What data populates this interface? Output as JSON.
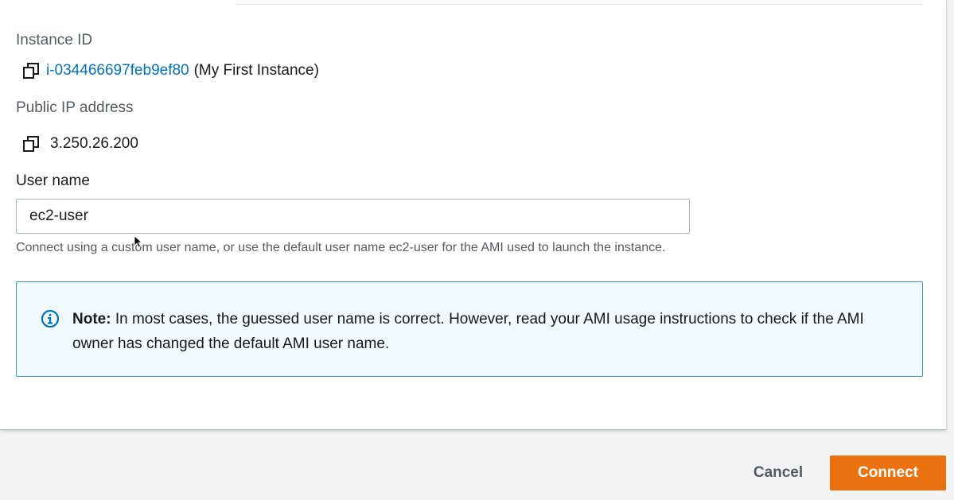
{
  "fields": {
    "instance_id": {
      "label": "Instance ID",
      "value": "i-034466697feb9ef80",
      "suffix": "(My First Instance)"
    },
    "public_ip": {
      "label": "Public IP address",
      "value": "3.250.26.200"
    },
    "user_name": {
      "label": "User name",
      "value": "ec2-user",
      "hint": "Connect using a custom user name, or use the default user name ec2-user for the AMI used to launch the instance."
    }
  },
  "note": {
    "title": "Note:",
    "text": "In most cases, the guessed user name is correct. However, read your AMI usage instructions to check if the AMI owner has changed the default AMI user name."
  },
  "footer": {
    "cancel_label": "Cancel",
    "connect_label": "Connect"
  },
  "icons": {
    "copy": "copy-icon",
    "info": "info-icon"
  },
  "colors": {
    "link": "#0073bb",
    "primary_button": "#ec7211",
    "info_border": "#3e96b8",
    "info_background": "#f1faff"
  }
}
